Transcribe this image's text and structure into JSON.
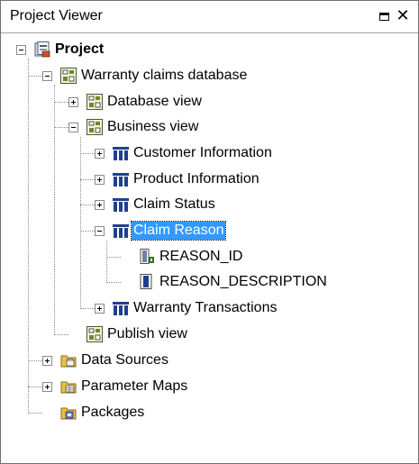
{
  "panel": {
    "title": "Project Viewer",
    "maximize_icon": "maximize-icon",
    "close_glyph": "✕"
  },
  "tree": {
    "project": "Project",
    "warranty_db": "Warranty claims database",
    "database_view": "Database view",
    "business_view": "Business view",
    "customer_info": "Customer Information",
    "product_info": "Product Information",
    "claim_status": "Claim Status",
    "claim_reason": "Claim Reason",
    "reason_id": "REASON_ID",
    "reason_description": "REASON_DESCRIPTION",
    "warranty_transactions": "Warranty Transactions",
    "publish_view": "Publish view",
    "data_sources": "Data Sources",
    "parameter_maps": "Parameter Maps",
    "packages": "Packages"
  },
  "colors": {
    "selection": "#3399ff",
    "namespace_green": "#6a8a2a",
    "query_subject_blue": "#1f3f8f",
    "folder_yellow": "#e8c04a"
  }
}
